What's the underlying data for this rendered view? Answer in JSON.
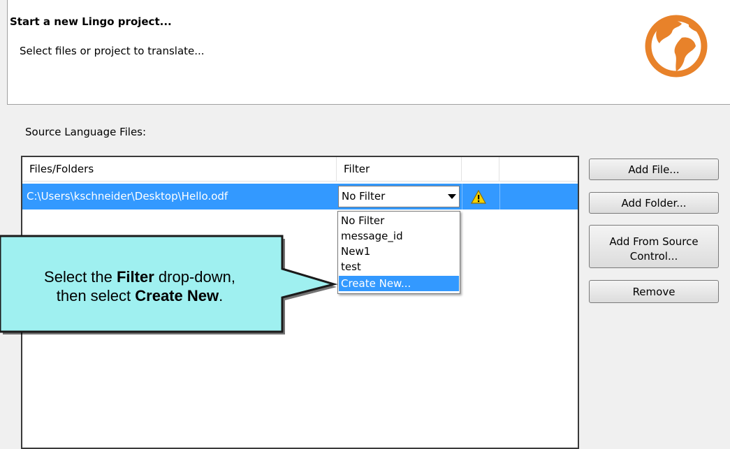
{
  "header": {
    "title": "Start a new Lingo project...",
    "subtitle": "Select files or project to translate..."
  },
  "source_section": {
    "label": "Source Language Files:"
  },
  "table": {
    "columns": [
      "Files/Folders",
      "Filter"
    ],
    "rows": [
      {
        "path": "C:\\Users\\kschneider\\Desktop\\Hello.odf",
        "filter": "No Filter",
        "status_icon": "warning-icon"
      }
    ]
  },
  "filter_dropdown": {
    "options": [
      "No Filter",
      "message_id",
      "New1",
      "test",
      "Create New..."
    ],
    "highlighted": "Create New..."
  },
  "buttons": {
    "add_file": "Add File...",
    "add_folder": "Add Folder...",
    "add_from_source_line1": "Add From Source",
    "add_from_source_line2": "Control...",
    "remove": "Remove"
  },
  "callout": {
    "line1_pre": "Select the ",
    "line1_bold": "Filter",
    "line1_post": " drop-down,",
    "line2_pre": "then select ",
    "line2_bold": "Create New",
    "line2_post": "."
  },
  "colors": {
    "selection": "#3399ff",
    "callout_fill": "#9ff0f0",
    "globe": "#e8822a"
  }
}
